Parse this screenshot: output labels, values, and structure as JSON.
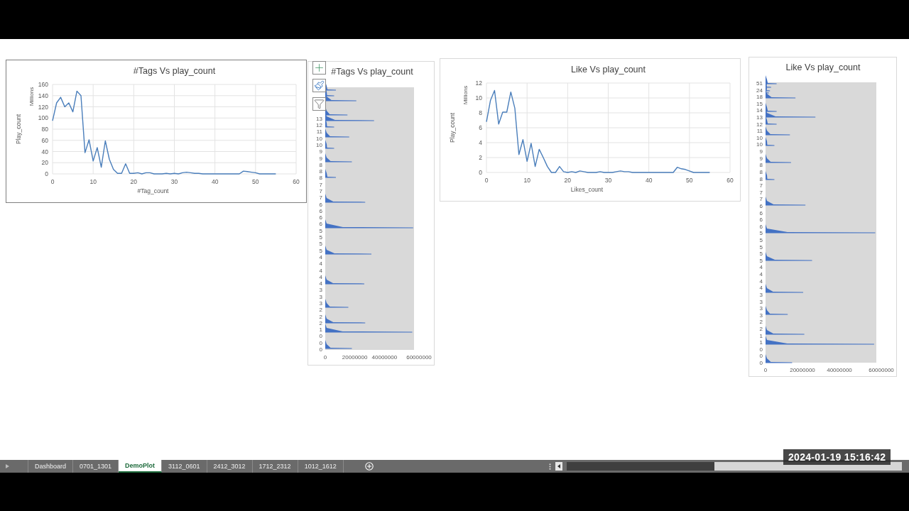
{
  "charts": [
    {
      "kind": "line",
      "unit_label": "Millions",
      "chart_data": {
        "type": "line",
        "title": "#Tags Vs play_count",
        "xlabel": "#Tag_count",
        "ylabel": "Play_count",
        "grid": true,
        "x": [
          0,
          1,
          2,
          3,
          4,
          5,
          6,
          7,
          8,
          9,
          10,
          11,
          12,
          13,
          14,
          15,
          16,
          17,
          18,
          19,
          20,
          21,
          22,
          23,
          24,
          25,
          26,
          27,
          28,
          29,
          30,
          31,
          32,
          33,
          34,
          35,
          36,
          37,
          38,
          39,
          40,
          41,
          42,
          43,
          44,
          45,
          46,
          47,
          48,
          49,
          50,
          51,
          52,
          53,
          54,
          55
        ],
        "series": [
          {
            "color": "#4a7ebb",
            "values": [
              95,
              127,
              137,
              120,
              127,
              111,
              148,
              140,
              38,
              61,
              23,
              47,
              12,
              59,
              26,
              8,
              1,
              1,
              18,
              1,
              1,
              2,
              0,
              2,
              2,
              0,
              0,
              0,
              1,
              0,
              1,
              0,
              2,
              3,
              2,
              1,
              1,
              0,
              0,
              0,
              0,
              0,
              0,
              0,
              0,
              0,
              0,
              5,
              4,
              3,
              2,
              0,
              0,
              0,
              0,
              0
            ]
          }
        ],
        "xlim": [
          0,
          60
        ],
        "ylim": [
          0,
          160
        ],
        "xticks": [
          0,
          10,
          20,
          30,
          40,
          50,
          60
        ],
        "yticks": [
          0,
          20,
          40,
          60,
          80,
          100,
          120,
          140,
          160
        ]
      }
    },
    {
      "kind": "bar",
      "title": "#Tags Vs play_count",
      "tools_shown": true,
      "y_labels": [
        "13",
        "12",
        "11",
        "10",
        "10",
        "9",
        "9",
        "8",
        "8",
        "8",
        "7",
        "7",
        "7",
        "6",
        "6",
        "6",
        "6",
        "5",
        "5",
        "5",
        "5",
        "4",
        "4",
        "4",
        "4",
        "4",
        "3",
        "3",
        "3",
        "2",
        "2",
        "2",
        "1",
        "0",
        "0",
        "0"
      ],
      "x_ticks": [
        "0",
        "20000000",
        "40000000",
        "60000000"
      ]
    },
    {
      "kind": "line",
      "unit_label": "Millions",
      "chart_data": {
        "type": "line",
        "title": "Like Vs play_count",
        "xlabel": "Likes_count",
        "ylabel": "Play_count",
        "grid": true,
        "x": [
          0,
          1,
          2,
          3,
          4,
          5,
          6,
          7,
          8,
          9,
          10,
          11,
          12,
          13,
          14,
          15,
          16,
          17,
          18,
          19,
          20,
          21,
          22,
          23,
          24,
          25,
          26,
          27,
          28,
          29,
          30,
          31,
          32,
          33,
          34,
          35,
          36,
          37,
          38,
          39,
          40,
          41,
          42,
          43,
          44,
          45,
          46,
          47,
          48,
          49,
          50,
          51,
          52,
          53,
          54,
          55
        ],
        "series": [
          {
            "color": "#4a7ebb",
            "values": [
              6.8,
              9.7,
              11,
              6.5,
              8.1,
              8.1,
              10.8,
              8.6,
              2.4,
              4.4,
              1.5,
              3.9,
              0.8,
              3.1,
              2,
              0.8,
              0,
              0,
              0.8,
              0.1,
              0,
              0.1,
              0,
              0.2,
              0.1,
              0,
              0,
              0,
              0.1,
              0,
              0,
              0,
              0.1,
              0.2,
              0.1,
              0.1,
              0,
              0,
              0,
              0,
              0,
              0,
              0,
              0,
              0,
              0,
              0,
              0.7,
              0.5,
              0.4,
              0.2,
              0,
              0,
              0,
              0,
              0
            ]
          }
        ],
        "xlim": [
          0,
          60
        ],
        "ylim": [
          0,
          12
        ],
        "xticks": [
          0,
          10,
          20,
          30,
          40,
          50,
          60
        ],
        "yticks": [
          0,
          2,
          4,
          6,
          8,
          10,
          12
        ]
      }
    },
    {
      "kind": "bar",
      "title": "Like Vs play_count",
      "tools_shown": false,
      "y_labels": [
        "51",
        "24",
        "18",
        "15",
        "14",
        "13",
        "12",
        "11",
        "10",
        "10",
        "9",
        "9",
        "8",
        "8",
        "8",
        "7",
        "7",
        "7",
        "6",
        "6",
        "6",
        "6",
        "5",
        "5",
        "5",
        "5",
        "5",
        "4",
        "4",
        "4",
        "4",
        "3",
        "3",
        "3",
        "3",
        "2",
        "2",
        "1",
        "1",
        "0",
        "0",
        "0"
      ],
      "x_ticks": [
        "0",
        "20000000",
        "40000000",
        "60000000"
      ]
    }
  ],
  "sheet_tabs": [
    {
      "label": "Dashboard",
      "selected": false
    },
    {
      "label": "0701_1301",
      "selected": false
    },
    {
      "label": "DemoPlot",
      "selected": true
    },
    {
      "label": "3112_0601",
      "selected": false
    },
    {
      "label": "2412_3012",
      "selected": false
    },
    {
      "label": "1712_2312",
      "selected": false
    },
    {
      "label": "1012_1612",
      "selected": false
    }
  ],
  "timestamp": "2024-01-19 15:16:42"
}
